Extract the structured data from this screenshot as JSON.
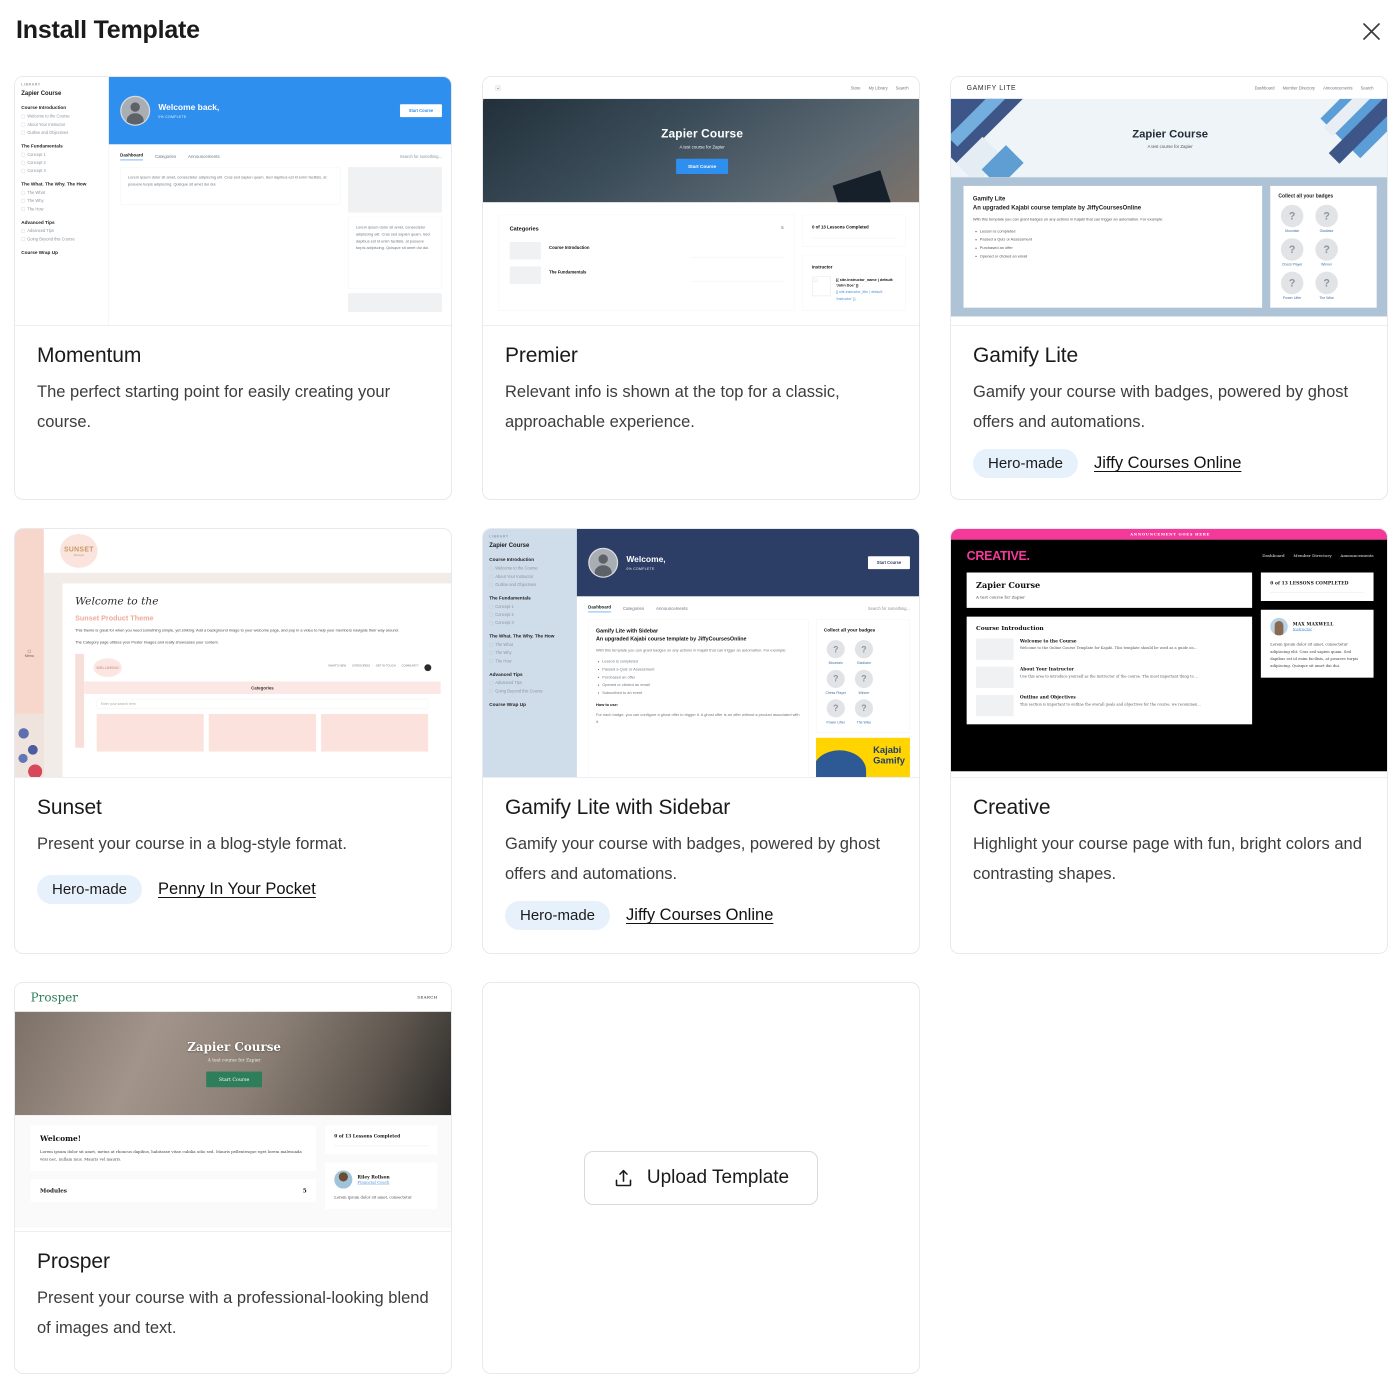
{
  "header": {
    "title": "Install Template",
    "close_label": "close-icon"
  },
  "templates": [
    {
      "name": "Momentum",
      "description": "The perfect starting point for easily creating your course.",
      "badge": null,
      "author": null,
      "preview": "momentum"
    },
    {
      "name": "Premier",
      "description": "Relevant info is shown at the top for a classic, approachable experience.",
      "badge": null,
      "author": null,
      "preview": "premier"
    },
    {
      "name": "Gamify Lite",
      "description": "Gamify your course with badges, powered by ghost offers and automations.",
      "badge": "Hero-made",
      "author": "Jiffy Courses Online",
      "preview": "gamify"
    },
    {
      "name": "Sunset",
      "description": "Present your course in a blog-style format.",
      "badge": "Hero-made",
      "author": "Penny In Your Pocket",
      "preview": "sunset"
    },
    {
      "name": "Gamify Lite with Sidebar",
      "description": "Gamify your course with badges, powered by ghost offers and automations.",
      "badge": "Hero-made",
      "author": "Jiffy Courses Online",
      "preview": "gamify_sidebar"
    },
    {
      "name": "Creative",
      "description": "Highlight your course page with fun, bright colors and contrasting shapes.",
      "badge": null,
      "author": null,
      "preview": "creative"
    },
    {
      "name": "Prosper",
      "description": "Present your course with a professional-looking blend of images and text.",
      "badge": null,
      "author": null,
      "preview": "prosper"
    }
  ],
  "upload": {
    "label": "Upload Template",
    "icon": "upload-icon"
  },
  "previews": {
    "library_label": "LIBRARY",
    "course_title": "Zapier Course",
    "course_subtitle": "A test course for Zapier",
    "start_course": "Start Course",
    "welcome_back": "Welcome back,",
    "welcome": "Welcome,",
    "percent_complete": "0% COMPLETE",
    "search_placeholder": "Search for something...",
    "tabs": [
      "Dashboard",
      "Categories",
      "Announcements"
    ],
    "sidebar_sections": [
      {
        "title": "Course Introduction",
        "items": [
          "Welcome to the Course",
          "About Your Instructor",
          "Outline and Objectives"
        ]
      },
      {
        "title": "The Fundamentals",
        "items": [
          "Concept 1",
          "Concept 2",
          "Concept 3"
        ]
      },
      {
        "title": "The What. The Why. The How",
        "items": [
          "The What",
          "The Why",
          "The How"
        ]
      },
      {
        "title": "Advanced Tips",
        "items": [
          "Advanced Tips",
          "Going Beyond this Course"
        ]
      },
      {
        "title": "Course Wrap Up",
        "items": []
      }
    ],
    "lorem_short": "Lorem ipsum dolor sit amet, consectetur adipiscing elit. Cras sed sapien quam. Sed dapibus est id enim facilisis, at posuere turpis adipiscing. Quisque sit amet dui dui.",
    "premier_nav": [
      "Store",
      "My Library",
      "Search"
    ],
    "premier_categories_label": "Categories",
    "premier_categories_count": "5",
    "premier_category_items": [
      "Course Introduction",
      "The Fundamentals"
    ],
    "lessons_completed": "0 of 13 Lessons Completed",
    "instructor_label": "Instructor",
    "instructor_name_token": "{{ site.instructor_name | default: 'John Doe' }}",
    "instructor_title_token": "{{ site.instructor_title | default: 'Instructor' }}",
    "gamify_logo": "GAMIFY LITE",
    "gamify_nav": [
      "Dashboard",
      "Member Directory",
      "Announcements",
      "Search"
    ],
    "gamify_heading_lite": "Gamify Lite",
    "gamify_heading_sidebar": "Gamify Lite with Sidebar",
    "gamify_subheading": "An upgraded Kajabi course template by JiffyCoursesOnline",
    "gamify_intro": "With this template you can grant badges on any actions in Kajabi that can trigger an automation. For example:",
    "gamify_bullets": [
      "Lesson is completed",
      "Passed a Quiz or Assessment",
      "Purchased an offer",
      "Opened or clicked an email",
      "Subscribed to an event"
    ],
    "gamify_howto_label": "How to use:",
    "gamify_howto_text": "For each badge, you can configure a ghost offer to trigger it. A ghost offer is an offer without a product associated with it.",
    "badges_title": "Collect all your badges",
    "badge_names": [
      "Mountain",
      "Gladiator",
      "Chess Player",
      "Winner",
      "Power Lifter",
      "The Wise"
    ],
    "badge_glyph": "?",
    "sunset_logo": "SUNSET",
    "sunset_logo_sub": "lifestyle",
    "sunset_menu": "Menu",
    "sunset_script": "Welcome to the",
    "sunset_heading": "Sunset Product Theme",
    "sunset_p1": "This theme is great for when you need something simple, yet striking. Add a background image to your welcome page, and pop in a video to help your members navigate their way around.",
    "sunset_p2": "The Category page utilizes your Poster images and really showcases your content.",
    "sunset_inner_logo": "WELLBEING",
    "sunset_inner_nav": [
      "WHAT'S NEW",
      "CATEGORIES",
      "GET IN TOUCH",
      "COMMUNITY"
    ],
    "sunset_categories": "Categories",
    "sunset_search_placeholder": "Enter your search term",
    "creative_announcement": "ANNOUNCEMENT GOES HERE",
    "creative_logo": "CREATIVE",
    "creative_logo_dot": ".",
    "creative_nav": [
      "Dashboard",
      "Member Directory",
      "Announcements"
    ],
    "creative_lessons": "0 of 13 LESSONS COMPLETED",
    "creative_instructor_name": "MAX MAXWELL",
    "creative_instructor_title": "Instructor",
    "creative_section": "Course Introduction",
    "creative_lessons_list": [
      {
        "title": "Welcome to the Course",
        "text": "Welcome to the Online Course Template for Kajabi. This template should be used as a guide on..."
      },
      {
        "title": "About Your Instructor",
        "text": "Use this area to introduce yourself as the instructor of the course. The most important thing to ..."
      },
      {
        "title": "Outline and Objectives",
        "text": "This section is important to outline the overall goals and objectives for the course, we recommen..."
      }
    ],
    "prosper_logo": "Prosper",
    "prosper_search": "SEARCH",
    "prosper_welcome": "Welcome!",
    "prosper_welcome_text": "Lorem ipsum dolor sit amet, metus at rhoncus dapibus, habitasse vitae cubilia odio sed. Mauris pellentesque eget lorem malesuada wisi nec, nullam mus. Mauris vel mauris.",
    "prosper_modules": "Modules",
    "prosper_modules_count": "5",
    "prosper_instructor_name": "Riley Rollson",
    "prosper_instructor_title": "Financial Coach",
    "prosper_instructor_text": "Lorem ipsum dolor sit amet, consectetur"
  }
}
